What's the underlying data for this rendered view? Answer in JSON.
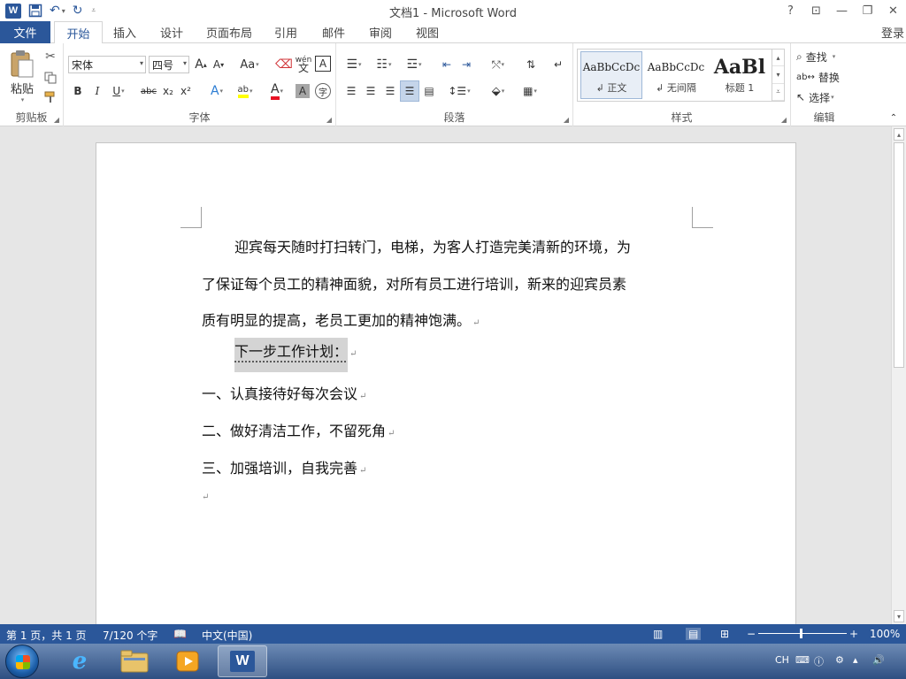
{
  "title_bar": {
    "title": "文档1 - Microsoft Word",
    "word_logo": "W",
    "undo_icon": "↶",
    "redo_icon": "↻",
    "help": "?",
    "ribbon_display": "⊡",
    "minimize": "—",
    "restore": "❐",
    "close": "✕"
  },
  "tabs": {
    "file": "文件",
    "items": [
      "开始",
      "插入",
      "设计",
      "页面布局",
      "引用",
      "邮件",
      "审阅",
      "视图"
    ],
    "active": "开始",
    "login": "登录"
  },
  "ribbon": {
    "clipboard": {
      "label": "剪贴板",
      "paste": "粘贴"
    },
    "font": {
      "label": "字体",
      "font_name": "宋体",
      "font_size": "四号",
      "grow": "A",
      "shrink": "A",
      "case": "Aa",
      "pinyin": "wén",
      "border_char": "A",
      "bold": "B",
      "italic": "I",
      "underline": "U",
      "strike": "abc",
      "subscript": "x₂",
      "superscript": "x²",
      "effects": "A",
      "highlight": "ab",
      "font_color": "A",
      "char_shading": "A",
      "enclose": "字"
    },
    "paragraph": {
      "label": "段落"
    },
    "styles": {
      "label": "样式",
      "items": [
        {
          "sample": "AaBbCcDc",
          "name": "↲ 正文"
        },
        {
          "sample": "AaBbCcDc",
          "name": "↲ 无间隔"
        },
        {
          "sample": "AaBl",
          "name": "标题 1"
        }
      ]
    },
    "editing": {
      "label": "编辑",
      "find": "查找",
      "replace": "替换",
      "select": "选择"
    }
  },
  "document": {
    "lines": [
      "迎宾每天随时打扫转门，电梯，为客人打造完美清新的环境，为",
      "了保证每个员工的精神面貌，对所有员工进行培训，新来的迎宾员素",
      "质有明显的提高，老员工更加的精神饱满。",
      "下一步工作计划：",
      "一、认真接待好每次会议",
      "二、做好清洁工作，不留死角",
      "三、加强培训，自我完善"
    ],
    "paragraph_mark": "↵"
  },
  "status_bar": {
    "page": "第 1 页，共 1 页",
    "words": "7/120 个字",
    "language": "中文(中国)",
    "zoom": "100%",
    "zoom_level": 1.0
  },
  "taskbar": {
    "ime": "CH"
  }
}
